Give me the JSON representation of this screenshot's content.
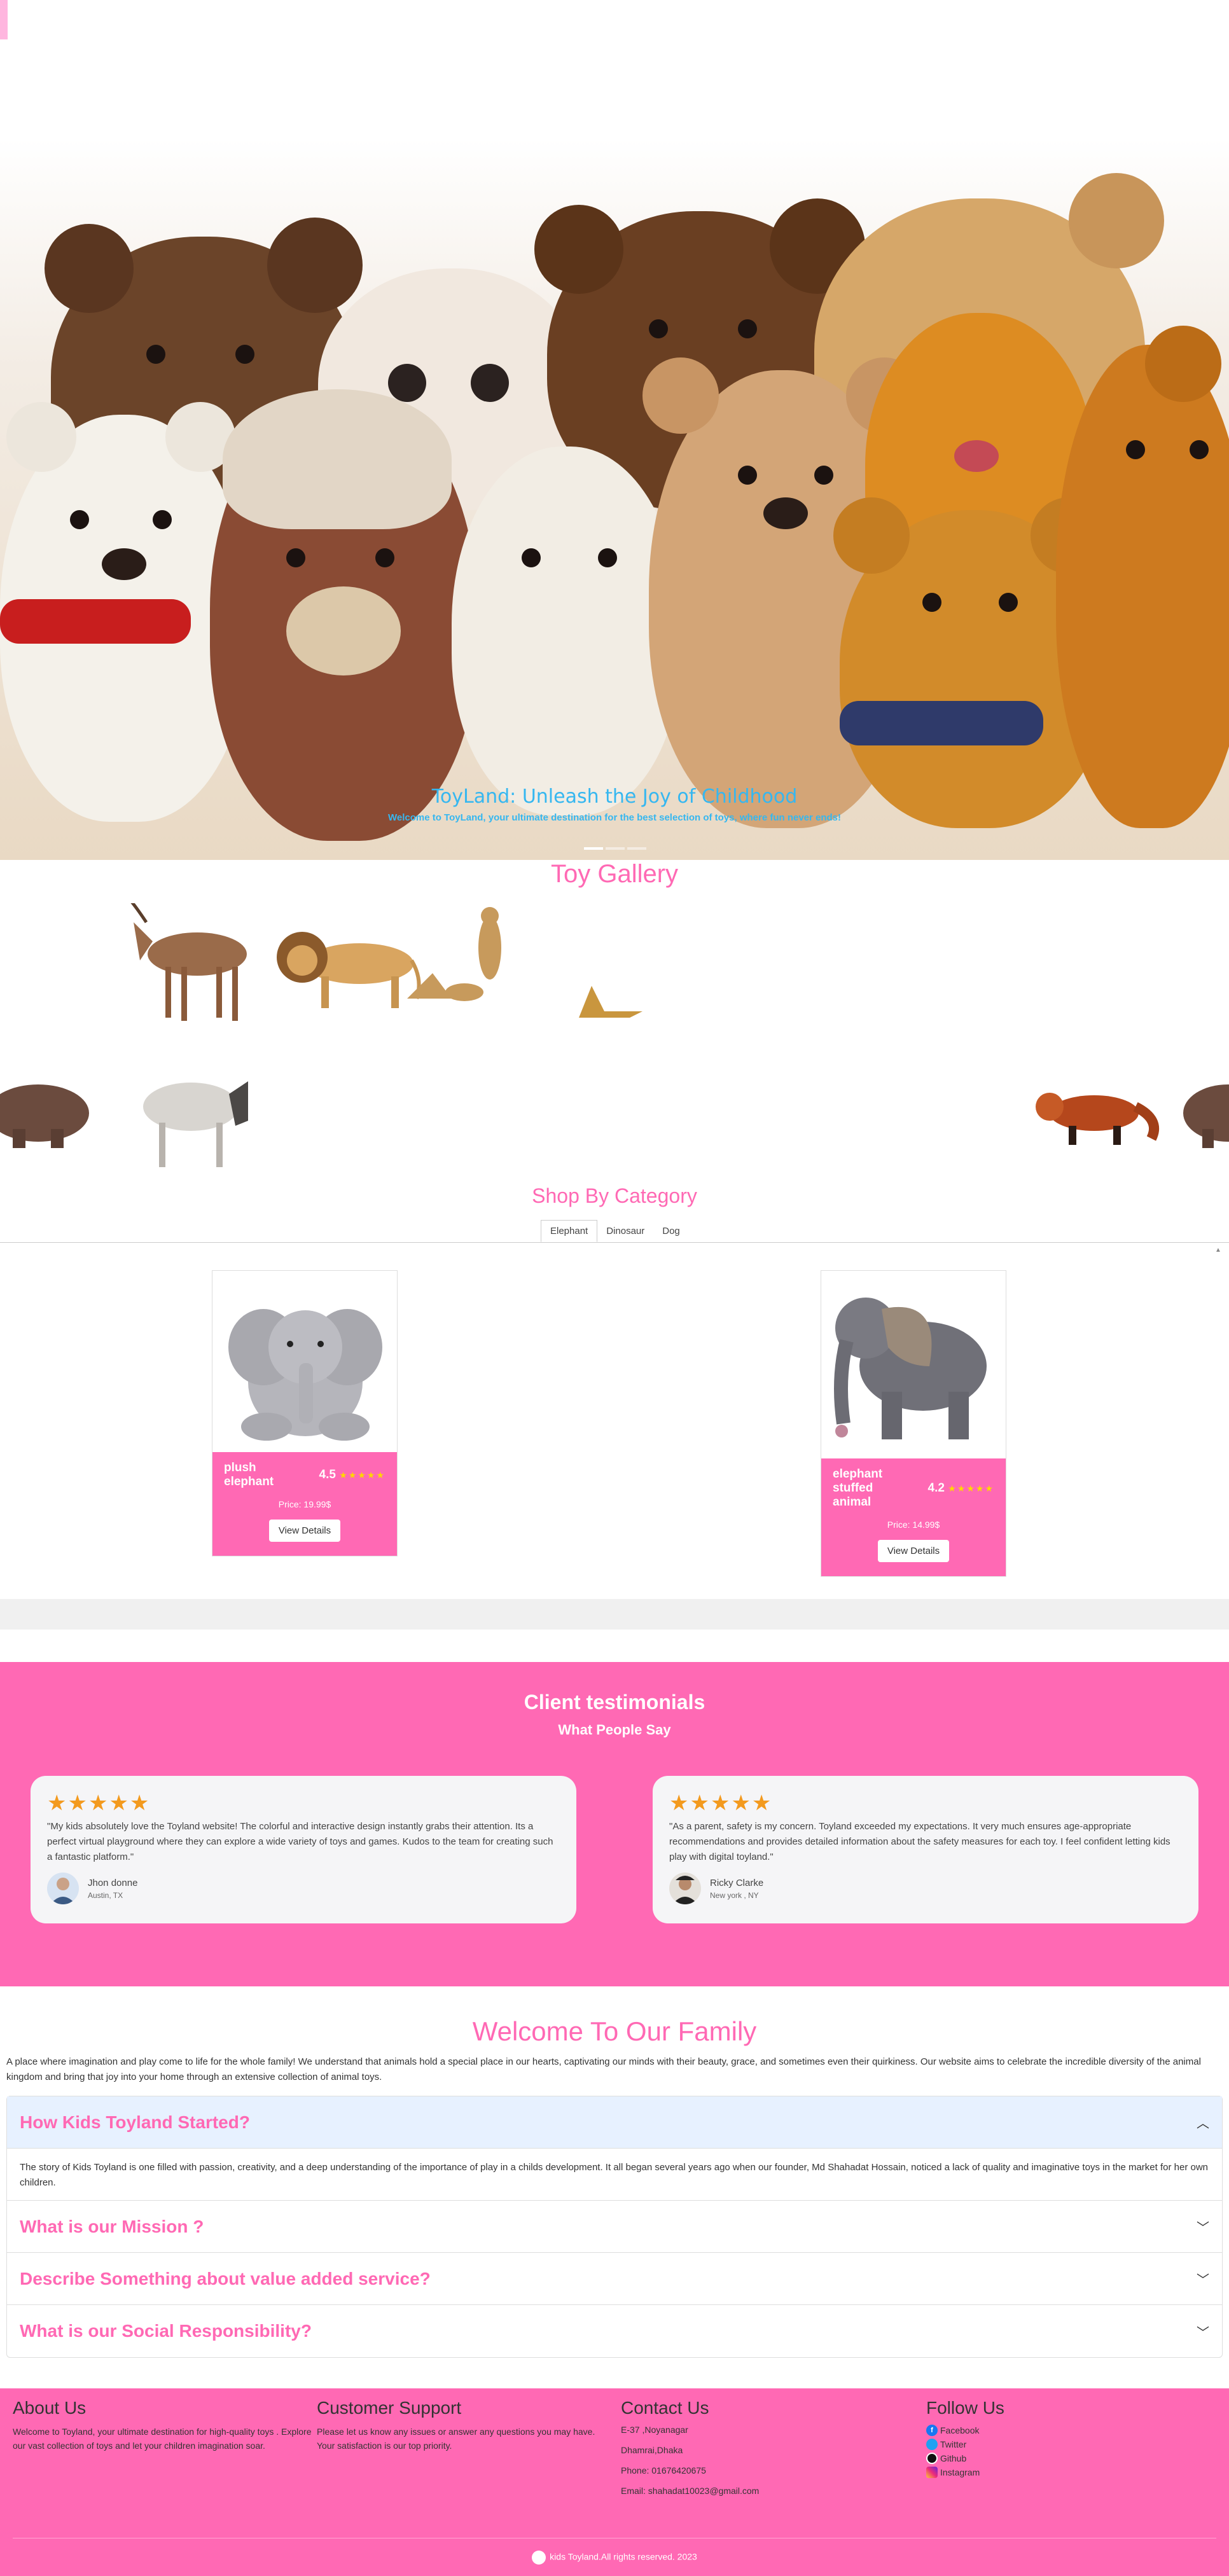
{
  "hero": {
    "title": "ToyLand: Unleash the Joy of Childhood",
    "subtitle": "Welcome to ToyLand, your ultimate destination for the best selection of toys, where fun never ends!"
  },
  "gallery": {
    "title": "Toy Gallery"
  },
  "category": {
    "title": "Shop By Category",
    "tabs": [
      "Elephant",
      "Dinosaur",
      "Dog"
    ],
    "active_tab": "Elephant",
    "cards": [
      {
        "name": "plush elephant",
        "rating": "4.5",
        "stars": "★★★★★",
        "price": "Price: 19.99$",
        "button": "View Details"
      },
      {
        "name": "elephant stuffed animal",
        "rating": "4.2",
        "stars": "★★★★★",
        "price": "Price: 14.99$",
        "button": "View Details"
      }
    ]
  },
  "testimonials": {
    "title": "Client testimonials",
    "subtitle": "What People Say",
    "items": [
      {
        "stars": "★★★★★",
        "text": "\"My kids absolutely love the Toyland website! The colorful and interactive design instantly grabs their attention. Its a perfect virtual playground where they can explore a wide variety of toys and games. Kudos to the team for creating such a fantastic platform.\"",
        "name": "Jhon donne",
        "location": "Austin, TX"
      },
      {
        "stars": "★★★★★",
        "text": "\"As a parent, safety is my concern. Toyland exceeded my expectations. It very much ensures age-appropriate recommendations and provides detailed information about the safety measures for each toy. I feel confident letting kids play with digital toyland.\"",
        "name": "Ricky Clarke",
        "location": "New york , NY"
      }
    ]
  },
  "family": {
    "title": "Welcome To Our Family",
    "description": "A place where imagination and play come to life for the whole family! We understand that animals hold a special place in our hearts, captivating our minds with their beauty, grace, and sometimes even their quirkiness. Our website aims to celebrate the incredible diversity of the animal kingdom and bring that joy into your home through an extensive collection of animal toys.",
    "accordion": [
      {
        "q": "How Kids Toyland Started?",
        "a": "The story of Kids Toyland is one filled with passion, creativity, and a deep understanding of the importance of play in a childs development. It all began several years ago when our founder, Md Shahadat Hossain, noticed a lack of quality and imaginative toys in the market for her own children."
      },
      {
        "q": "What is our Mission ?"
      },
      {
        "q": "Describe Something about value added service?"
      },
      {
        "q": "What is our Social Responsibility?"
      }
    ]
  },
  "footer": {
    "about_title": "About Us",
    "about_text": "Welcome to Toyland, your ultimate destination for high-quality toys . Explore our vast collection of toys and let your children imagination soar.",
    "support_title": "Customer Support",
    "support_text": "Please let us know any issues or answer any questions you may have. Your satisfaction is our top priority.",
    "contact_title": "Contact Us",
    "contact_lines": [
      "E-37 ,Noyanagar",
      "Dhamrai,Dhaka",
      "Phone: 01676420675",
      "Email: shahadat10023@gmail.com"
    ],
    "follow_title": "Follow Us",
    "social": [
      "Facebook",
      "Twitter",
      "Github",
      "Instagram"
    ],
    "copyright": "kids Toyland.All rights reserved. 2023"
  },
  "colors": {
    "brand": "#ff69b4",
    "hero_text": "#35b7f0",
    "star": "#f39a1e"
  }
}
